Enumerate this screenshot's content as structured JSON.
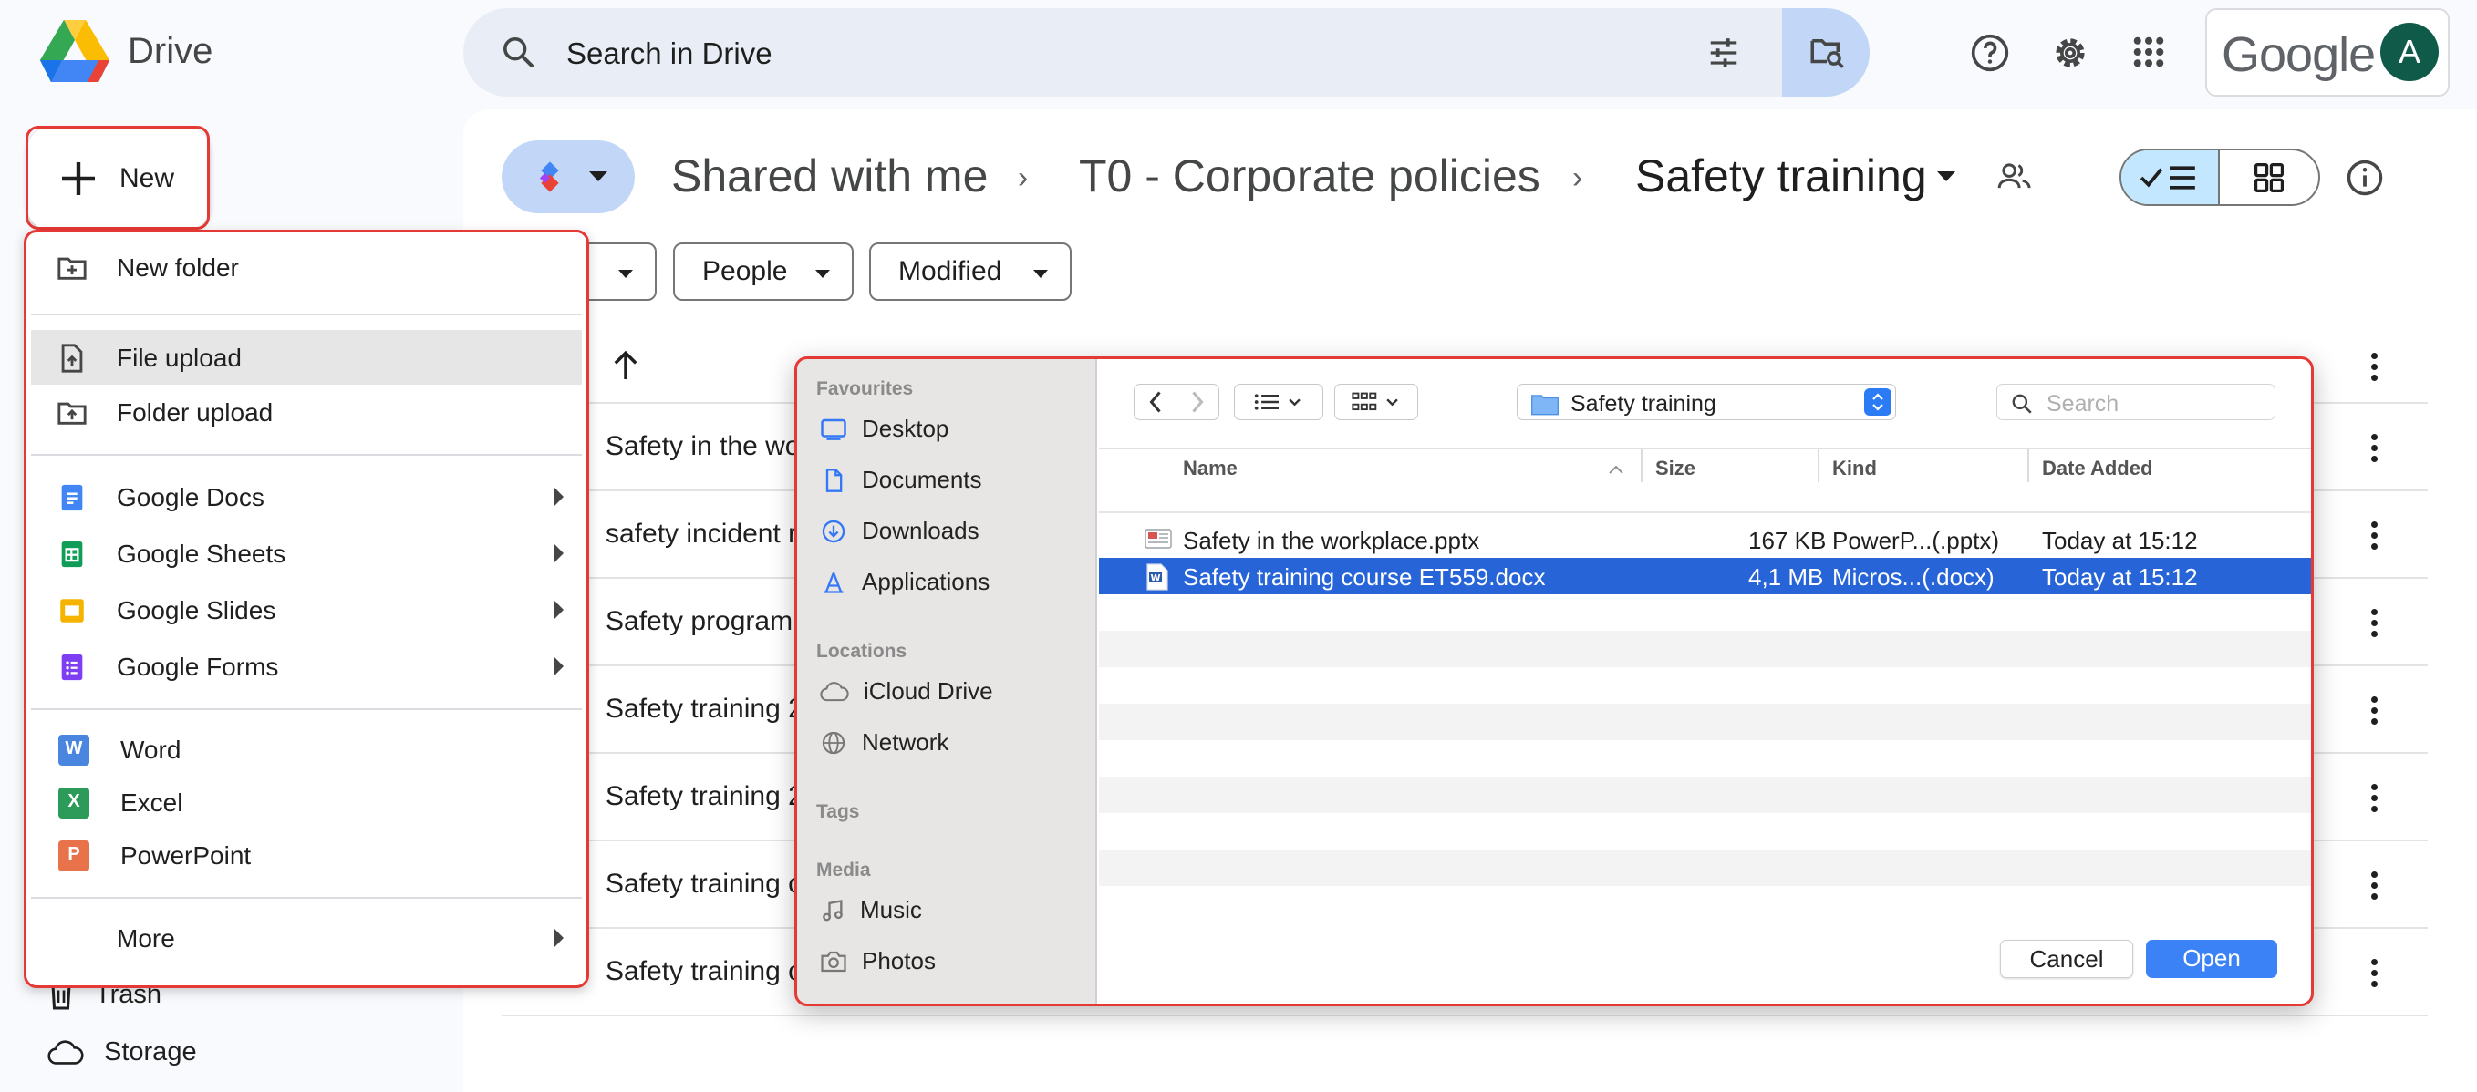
{
  "app": {
    "name": "Drive"
  },
  "search": {
    "placeholder": "Search in Drive"
  },
  "account": {
    "brand": "Google",
    "avatar_letter": "A"
  },
  "breadcrumb": {
    "items": [
      "Shared with me",
      "T0 - Corporate policies",
      "Safety training"
    ]
  },
  "filters": [
    "People",
    "Modified"
  ],
  "files": [
    "Safety in the wo",
    "safety incident r",
    "Safety program",
    "Safety training 2",
    "Safety training 2",
    "Safety training c",
    "Safety training c"
  ],
  "new_button": {
    "label": "New"
  },
  "sidebar": {
    "trash": "Trash",
    "storage": "Storage"
  },
  "new_menu": {
    "new_folder": "New folder",
    "file_upload": "File upload",
    "folder_upload": "Folder upload",
    "google_docs": "Google Docs",
    "google_sheets": "Google Sheets",
    "google_slides": "Google Slides",
    "google_forms": "Google Forms",
    "word": "Word",
    "excel": "Excel",
    "powerpoint": "PowerPoint",
    "more": "More"
  },
  "file_dialog": {
    "sidebar": {
      "favourites_heading": "Favourites",
      "favourites": [
        "Desktop",
        "Documents",
        "Downloads",
        "Applications"
      ],
      "locations_heading": "Locations",
      "locations": [
        "iCloud Drive",
        "Network"
      ],
      "tags_heading": "Tags",
      "media_heading": "Media",
      "media": [
        "Music",
        "Photos"
      ]
    },
    "current_folder": "Safety training",
    "search_placeholder": "Search",
    "columns": {
      "name": "Name",
      "size": "Size",
      "kind": "Kind",
      "date": "Date Added"
    },
    "rows": [
      {
        "name": "Safety in the workplace.pptx",
        "size": "167 KB",
        "kind": "PowerP...(.pptx)",
        "date": "Today at 15:12",
        "selected": false
      },
      {
        "name": "Safety training course ET559.docx",
        "size": "4,1 MB",
        "kind": "Micros...(.docx)",
        "date": "Today at 15:12",
        "selected": true
      }
    ],
    "cancel_label": "Cancel",
    "open_label": "Open"
  },
  "colors": {
    "accent": "#0b57d0",
    "highlight_outline": "#e53935",
    "selection": "#2664d8",
    "docs": "#4285f4",
    "sheets": "#0f9d58",
    "slides": "#f4b400",
    "forms": "#7e3ff2"
  }
}
